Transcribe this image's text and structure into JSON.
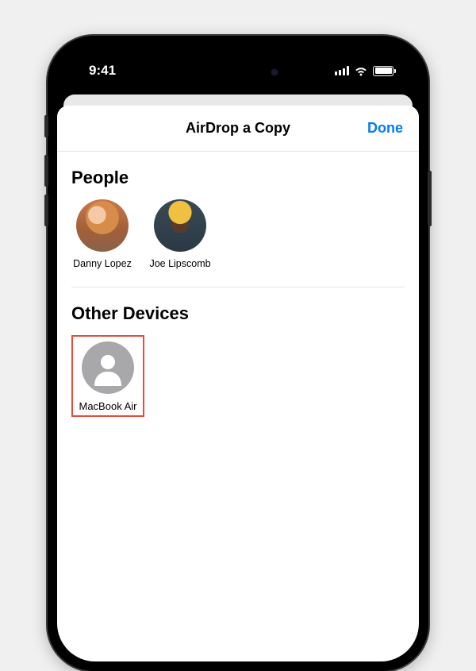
{
  "status": {
    "time": "9:41"
  },
  "sheet": {
    "title": "AirDrop a Copy",
    "done_label": "Done"
  },
  "sections": {
    "people": {
      "title": "People",
      "items": [
        {
          "name": "Danny Lopez"
        },
        {
          "name": "Joe Lipscomb"
        }
      ]
    },
    "devices": {
      "title": "Other Devices",
      "items": [
        {
          "name": "MacBook Air",
          "highlighted": true
        }
      ]
    }
  }
}
